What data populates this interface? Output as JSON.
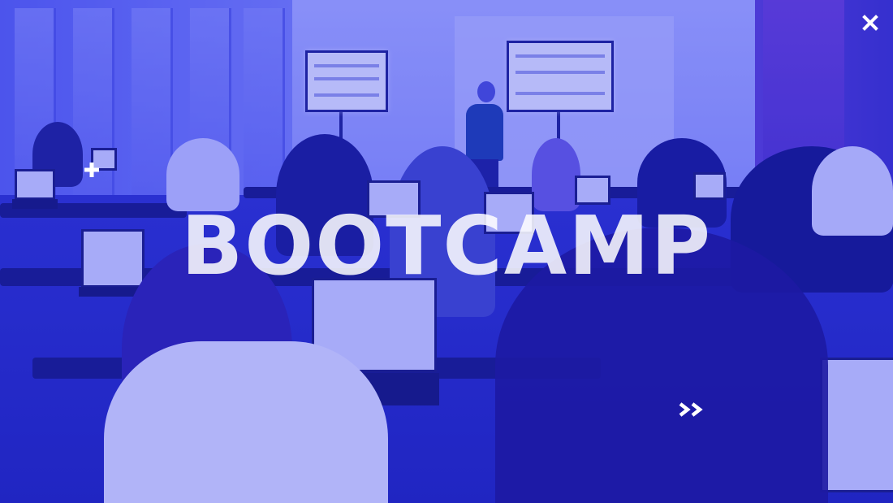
{
  "slide": {
    "headline": "BOOTCAMP",
    "background": "classroom-photo-blue-duotone",
    "accent_color": "#3038dc"
  },
  "controls": {
    "close_icon": "close-icon",
    "next_icon": "double-chevron-right-icon",
    "decor_icon": "plus-icon"
  }
}
